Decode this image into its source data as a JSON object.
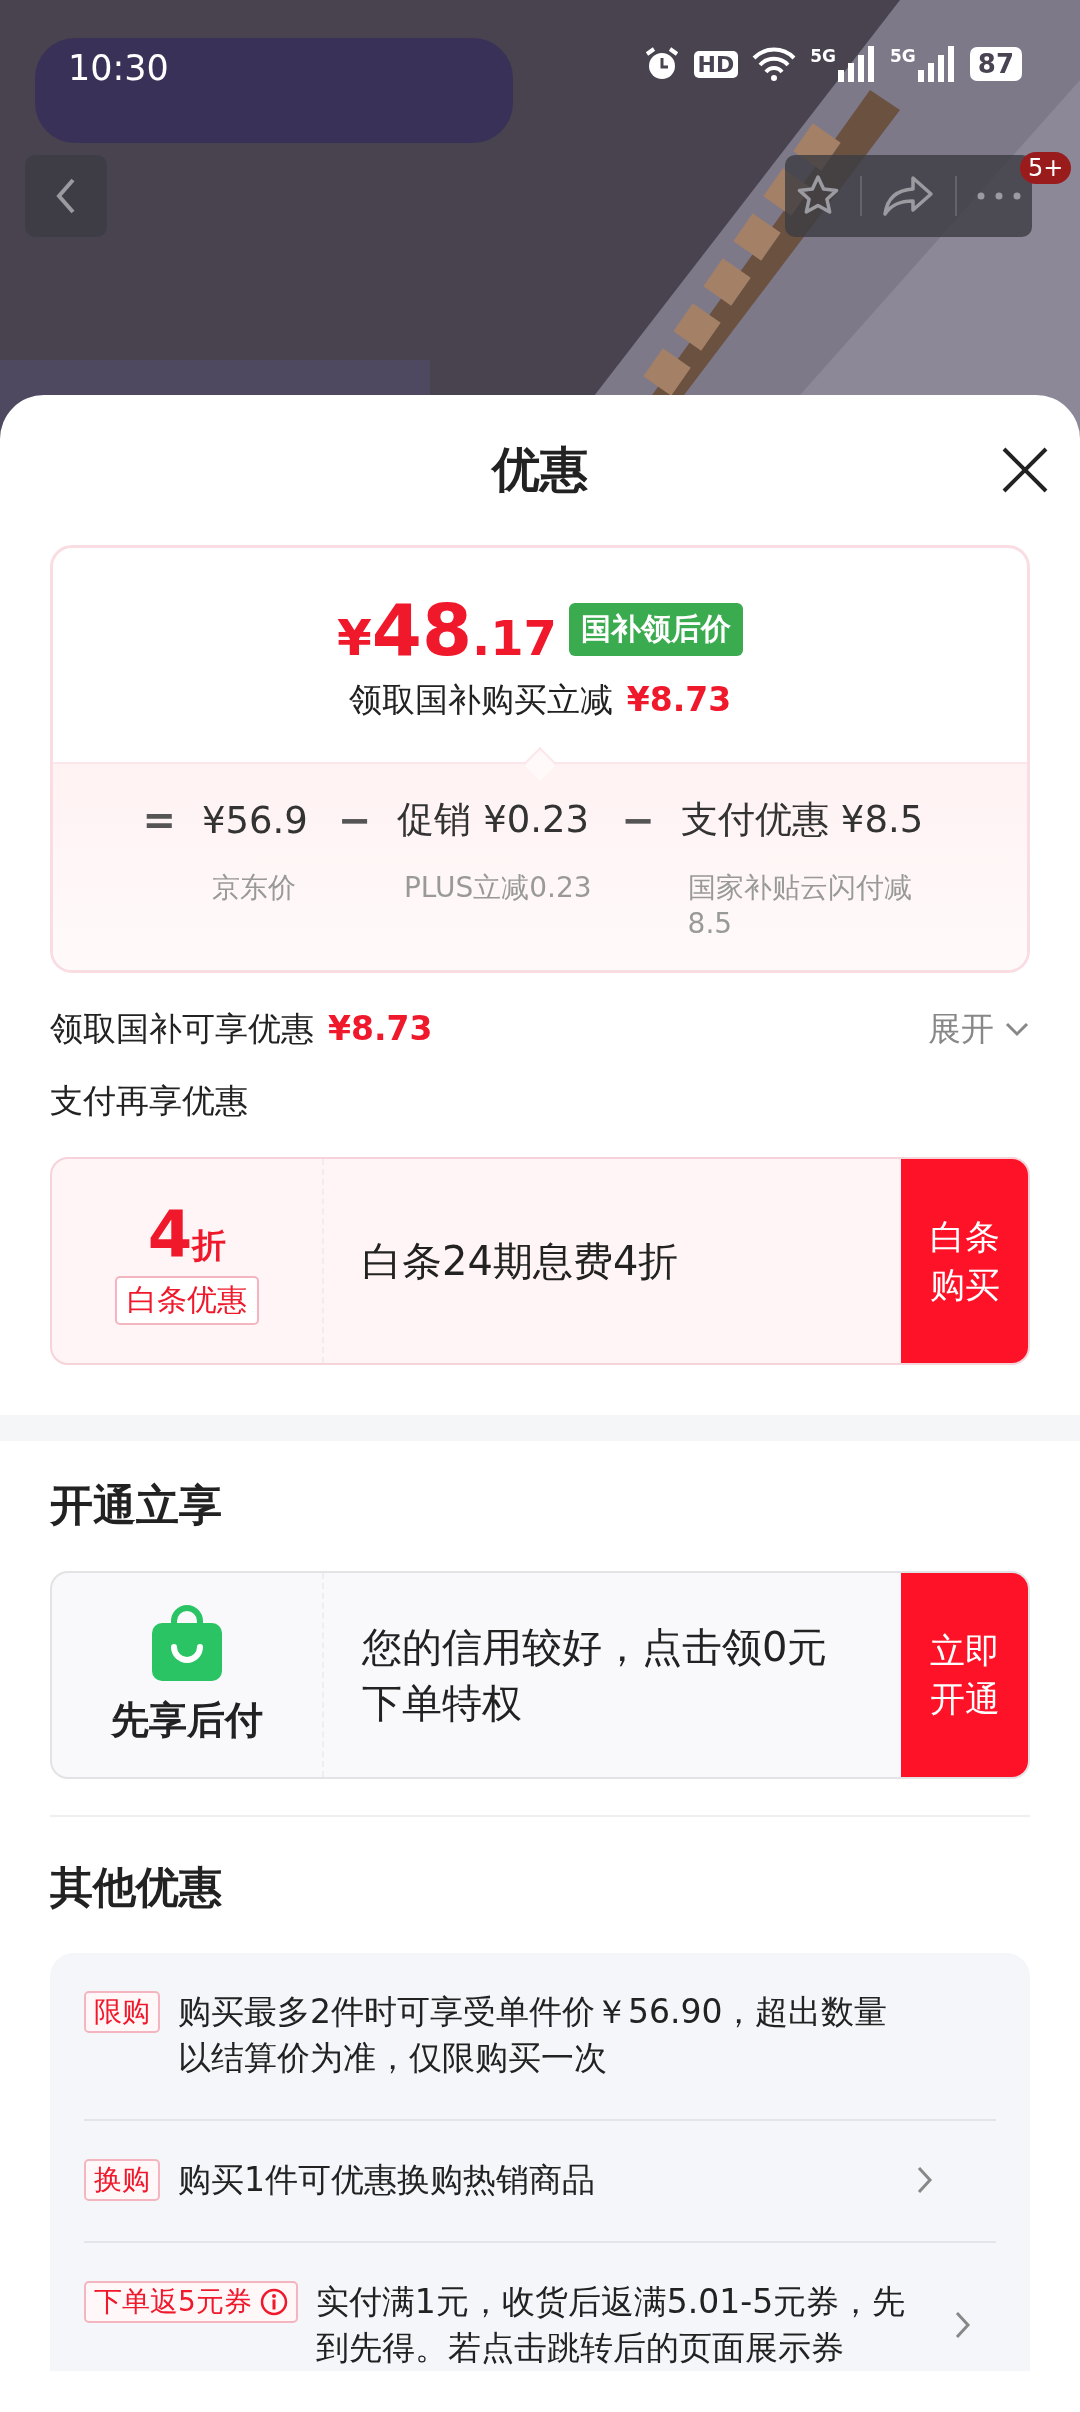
{
  "status_bar": {
    "time": "10:30",
    "hd": "HD",
    "network": [
      "5G",
      "5G"
    ],
    "battery": "87"
  },
  "header": {
    "badge": "5+"
  },
  "sheet": {
    "title": "优惠"
  },
  "price_card": {
    "price_symbol": "¥",
    "price_int": "48",
    "price_dec": ".17",
    "price_tag": "国补领后价",
    "subtitle": "领取国补购买立减",
    "subtitle_amount": "¥8.73",
    "breakdown": [
      {
        "operator": "=",
        "value": "¥56.9",
        "note": "京东价"
      },
      {
        "operator": "−",
        "value": "促销 ¥0.23",
        "note": "PLUS立减0.23"
      },
      {
        "operator": "−",
        "value": "支付优惠 ¥8.5",
        "note": "国家补贴云闪付减8.5"
      }
    ]
  },
  "subsidy_row": {
    "label": "领取国补可享优惠",
    "amount": "¥8.73",
    "toggle": "展开",
    "expanded": false
  },
  "pay_section": {
    "label": "支付再享优惠",
    "offer": {
      "kind": "discount",
      "big": "4",
      "unit": "折",
      "tag": "白条优惠",
      "text": "白条24期息费4折",
      "button": "白条购买"
    }
  },
  "open_section": {
    "title": "开通立享",
    "offer": {
      "kind": "service",
      "name": "先享后付",
      "text": "您的信用较好，点击领0元下单特权",
      "button": "立即开通"
    }
  },
  "other_section": {
    "title": "其他优惠",
    "items": [
      {
        "tag": "限购",
        "info": false,
        "text": "购买最多2件时可享受单件价￥56.90，超出数量以结算价为准，仅限购买一次",
        "arrow": false
      },
      {
        "tag": "换购",
        "info": false,
        "text": "购买1件可优惠换购热销商品",
        "arrow": true
      },
      {
        "tag": "下单返5元券",
        "info": true,
        "text": "实付满1元，收货后返满5.01-5元券，先到先得。若点击跳转后的页面展示券",
        "arrow": true
      }
    ]
  }
}
